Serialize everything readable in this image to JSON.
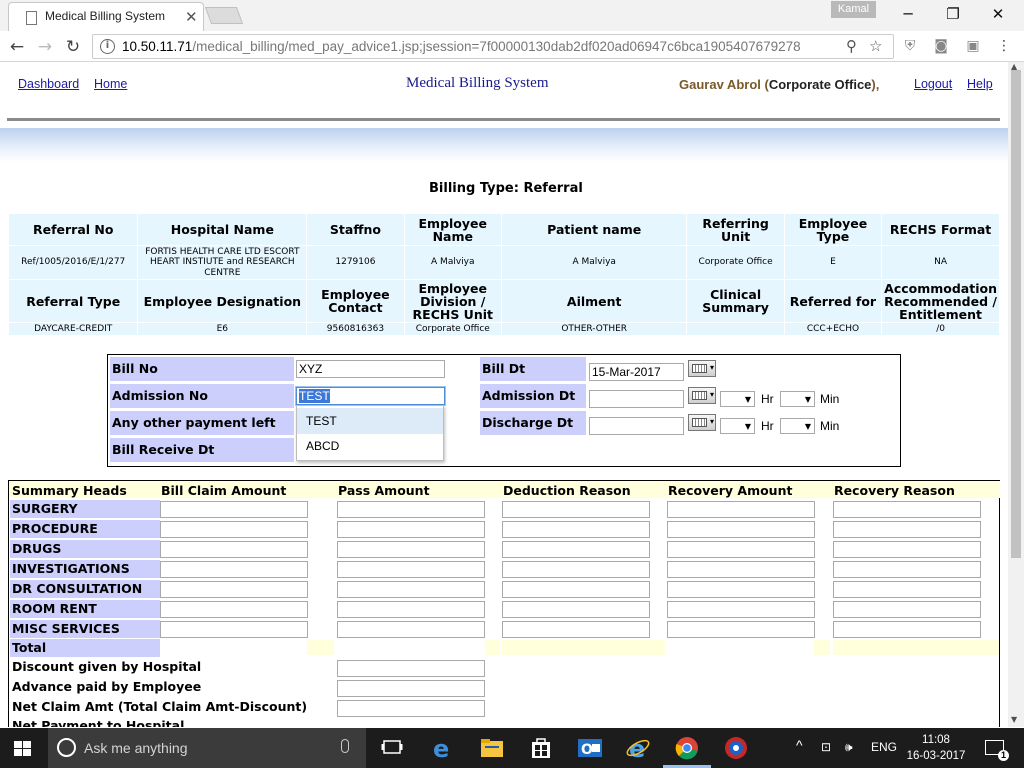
{
  "browser": {
    "tab_title": "Medical Billing System",
    "tab_close": "✕",
    "profile_name": "Kamal",
    "url_host": "10.50.11.71",
    "url_path": "/medical_billing/med_pay_advice1.jsp;jsession=7f00000130dab2df020ad06947c6bca1905407679278"
  },
  "nav": {
    "dashboard": "Dashboard",
    "home": "Home",
    "system_title": "Medical Billing System",
    "user_name": "Gaurav Abrol",
    "user_office": "Corporate Office",
    "logout": "Logout",
    "help": "Help"
  },
  "billing_type": "Billing Type:  Referral",
  "referral": {
    "headers1": [
      "Referral No",
      "Hospital Name",
      "Staffno",
      "Employee Name",
      "Patient name",
      "Referring Unit",
      "Employee Type",
      "RECHS Format"
    ],
    "values1": [
      "Ref/1005/2016/E/1/277",
      "FORTIS HEALTH CARE LTD ESCORT HEART INSTIUTE and RESEARCH CENTRE",
      "1279106",
      "A Malviya",
      "A Malviya",
      "Corporate Office",
      "E",
      "NA"
    ],
    "headers2": [
      "Referral Type",
      "Employee Designation",
      "Employee Contact",
      "Employee Division / RECHS Unit",
      "Ailment",
      "Clinical Summary",
      "Referred for",
      "Accommodation Recommended / Entitlement"
    ],
    "values2": [
      "DAYCARE-CREDIT",
      "E6",
      "9560816363",
      "Corporate Office",
      "OTHER-OTHER",
      "",
      "CCC+ECHO",
      "/0"
    ]
  },
  "bill": {
    "bill_no_label": "Bill No",
    "bill_no_value": "XYZ",
    "admission_no_label": "Admission No",
    "admission_no_value": "TEST",
    "other_payment_label": "Any other payment left",
    "bill_receive_label": "Bill Receive Dt",
    "bill_dt_label": "Bill Dt",
    "bill_dt_value": "15-Mar-2017",
    "admission_dt_label": "Admission Dt",
    "discharge_dt_label": "Discharge Dt",
    "hr": "Hr",
    "min": "Min",
    "autocomplete": [
      "TEST",
      "ABCD"
    ]
  },
  "summary": {
    "headers": [
      "Summary Heads",
      "Bill Claim Amount",
      "Pass Amount",
      "Deduction Reason",
      "Recovery Amount",
      "Recovery Reason"
    ],
    "rows": [
      "SURGERY",
      "PROCEDURE",
      "DRUGS",
      "INVESTIGATIONS",
      "DR CONSULTATION",
      "ROOM RENT",
      "MISC SERVICES"
    ],
    "total": "Total",
    "discount": "Discount given by Hospital",
    "advance": "Advance paid by Employee",
    "net_claim": "Net Claim Amt (Total Claim Amt-Discount)",
    "net_payment": "Net Payment to Hospital"
  },
  "taskbar": {
    "search_placeholder": "Ask me anything",
    "lang": "ENG",
    "time": "11:08",
    "date": "16-03-2017",
    "notification_count": "1"
  },
  "colors": {
    "label_bg": "#cccffc",
    "table_bg": "#e6f6ff",
    "header_bg": "#ffffdc",
    "link": "#1a1aa6"
  }
}
